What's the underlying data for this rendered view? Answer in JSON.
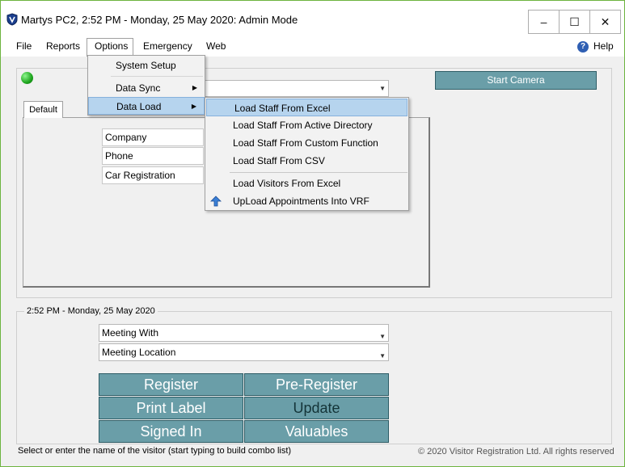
{
  "titlebar": {
    "title": "Martys PC2, 2:52 PM - Monday, 25 May 2020: Admin Mode",
    "minimize_glyph": "–",
    "maximize_glyph": "☐",
    "close_glyph": "✕"
  },
  "menubar": {
    "items": [
      "File",
      "Reports",
      "Options",
      "Emergency",
      "Web"
    ],
    "help_label": "Help",
    "help_icon_glyph": "?"
  },
  "options_menu": {
    "items": [
      {
        "label": "System Setup",
        "has_submenu": false
      },
      {
        "label": "Data Sync",
        "has_submenu": true
      },
      {
        "label": "Data Load",
        "has_submenu": true,
        "highlighted": true
      }
    ],
    "submenu_arrow": "▶"
  },
  "data_load_submenu": {
    "items": [
      {
        "label": "Load Staff From Excel",
        "highlighted": true
      },
      {
        "label": "Load Staff From Active Directory"
      },
      {
        "label": "Load Staff From Custom Function"
      },
      {
        "label": "Load Staff From CSV"
      },
      {
        "label": "Load Visitors From Excel"
      },
      {
        "label": "UpLoad Appointments Into VRF",
        "icon": "upload-arrow-icon"
      }
    ]
  },
  "top_panel": {
    "status_light_color": "#1ea51e",
    "start_camera_label": "Start Camera",
    "tab_label": "Default",
    "fields": [
      "Company",
      "Phone",
      "Car Registration"
    ],
    "combo_arrow": "▼"
  },
  "bottom_panel": {
    "group_legend": "2:52 PM - Monday, 25 May 2020",
    "meeting_with": "Meeting With",
    "meeting_location": "Meeting Location",
    "buttons": [
      "Register",
      "Pre-Register",
      "Print Label",
      "Update",
      "Signed In",
      "Valuables"
    ]
  },
  "statusbar": {
    "hint": "Select or enter the name of the visitor (start typing to build combo list)",
    "copyright": "© 2020 Visitor Registration Ltd. All rights reserved"
  },
  "colors": {
    "button_teal": "#6a9ea8",
    "highlight": "#b6d4ee",
    "window_border": "#6db43f"
  }
}
